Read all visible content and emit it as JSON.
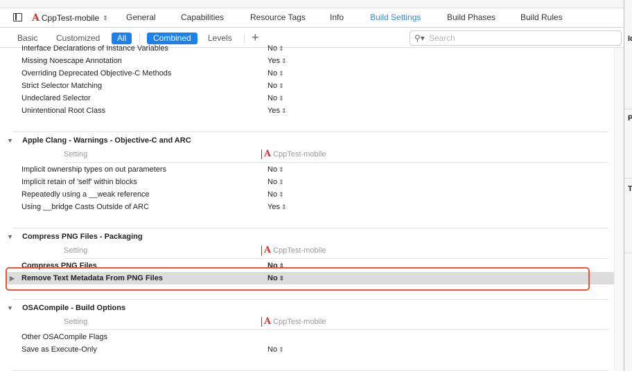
{
  "tabs": {
    "target": "CppTest-mobile",
    "items": [
      "General",
      "Capabilities",
      "Resource Tags",
      "Info",
      "Build Settings",
      "Build Phases",
      "Build Rules"
    ],
    "active": "Build Settings"
  },
  "filters": {
    "basic": "Basic",
    "customized": "Customized",
    "all": "All",
    "combined": "Combined",
    "levels": "Levels",
    "add": "+"
  },
  "search": {
    "placeholder": "Search",
    "value": ""
  },
  "top_rows": [
    {
      "label": "Interface Declarations of Instance Variables",
      "value": "No"
    },
    {
      "label": "Missing Noescape Annotation",
      "value": "Yes"
    },
    {
      "label": "Overriding Deprecated Objective-C Methods",
      "value": "No"
    },
    {
      "label": "Strict Selector Matching",
      "value": "No"
    },
    {
      "label": "Undeclared Selector",
      "value": "No"
    },
    {
      "label": "Unintentional Root Class",
      "value": "Yes"
    }
  ],
  "sections": [
    {
      "title": "Apple Clang - Warnings - Objective-C and ARC",
      "setting": "Setting",
      "target": "CppTest-mobile",
      "rows": [
        {
          "label": "Implicit ownership types on out parameters",
          "value": "No"
        },
        {
          "label": "Implicit retain of 'self' within blocks",
          "value": "No"
        },
        {
          "label": "Repeatedly using a __weak reference",
          "value": "No"
        },
        {
          "label": "Using __bridge Casts Outside of ARC",
          "value": "Yes"
        }
      ]
    },
    {
      "title": "Compress PNG Files - Packaging",
      "setting": "Setting",
      "target": "CppTest-mobile",
      "rows": [
        {
          "label": "Compress PNG Files",
          "value": "No"
        },
        {
          "label": "Remove Text Metadata From PNG Files",
          "value": "No"
        }
      ]
    },
    {
      "title": "OSACompile - Build Options",
      "setting": "Setting",
      "target": "CppTest-mobile",
      "rows": [
        {
          "label": "Other OSACompile Flags",
          "value": ""
        },
        {
          "label": "Save as Execute-Only",
          "value": "No"
        }
      ]
    }
  ],
  "highlight_color": "#f0513a",
  "accent": "#1a82f0",
  "right_panel": {
    "labels": [
      "Id",
      "P",
      "T"
    ]
  }
}
